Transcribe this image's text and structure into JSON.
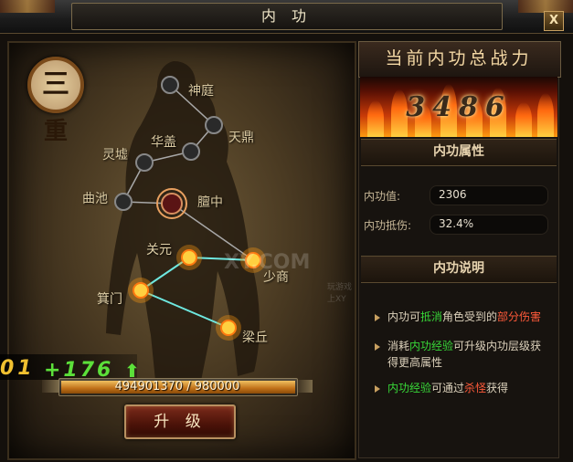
{
  "window": {
    "title": "内 功",
    "close_label": "X"
  },
  "level": {
    "number": "三",
    "suffix": "重"
  },
  "meridian_nodes": [
    {
      "label": "神庭",
      "state": "dark"
    },
    {
      "label": "天鼎",
      "state": "dark"
    },
    {
      "label": "华盖",
      "state": "dark"
    },
    {
      "label": "灵墟",
      "state": "dark"
    },
    {
      "label": "曲池",
      "state": "dark"
    },
    {
      "label": "膻中",
      "state": "current"
    },
    {
      "label": "关元",
      "state": "lit"
    },
    {
      "label": "少商",
      "state": "lit"
    },
    {
      "label": "箕门",
      "state": "lit"
    },
    {
      "label": "梁丘",
      "state": "lit"
    }
  ],
  "watermark": {
    "text": "XY.COM",
    "sub": "玩游戏上XY"
  },
  "exp": {
    "prefix": "01",
    "gain": "+176",
    "current": 494901370,
    "max": 980000,
    "text": "494901370 / 980000",
    "fill_fraction": 1.0
  },
  "upgrade_button": {
    "label": "升 级"
  },
  "power": {
    "banner": "当前内功总战力",
    "value": "3486"
  },
  "attributes": {
    "header": "内功属性",
    "items": [
      {
        "label": "内功值:",
        "value": "2306"
      },
      {
        "label": "内功抵伤:",
        "value": "32.4%"
      }
    ]
  },
  "description": {
    "header": "内功说明",
    "items": [
      {
        "parts": [
          "内功可",
          "抵消",
          "角色受到的",
          "部分伤害"
        ]
      },
      {
        "parts": [
          "消耗",
          "内功经验",
          "可升级内功层级获得更高属性"
        ]
      },
      {
        "parts": [
          "内功经验",
          "可通过",
          "杀怪",
          "获得"
        ]
      }
    ]
  },
  "colors": {
    "highlight_green": "#38d838",
    "highlight_red": "#ff5a3a",
    "gold": "#f0c030"
  }
}
